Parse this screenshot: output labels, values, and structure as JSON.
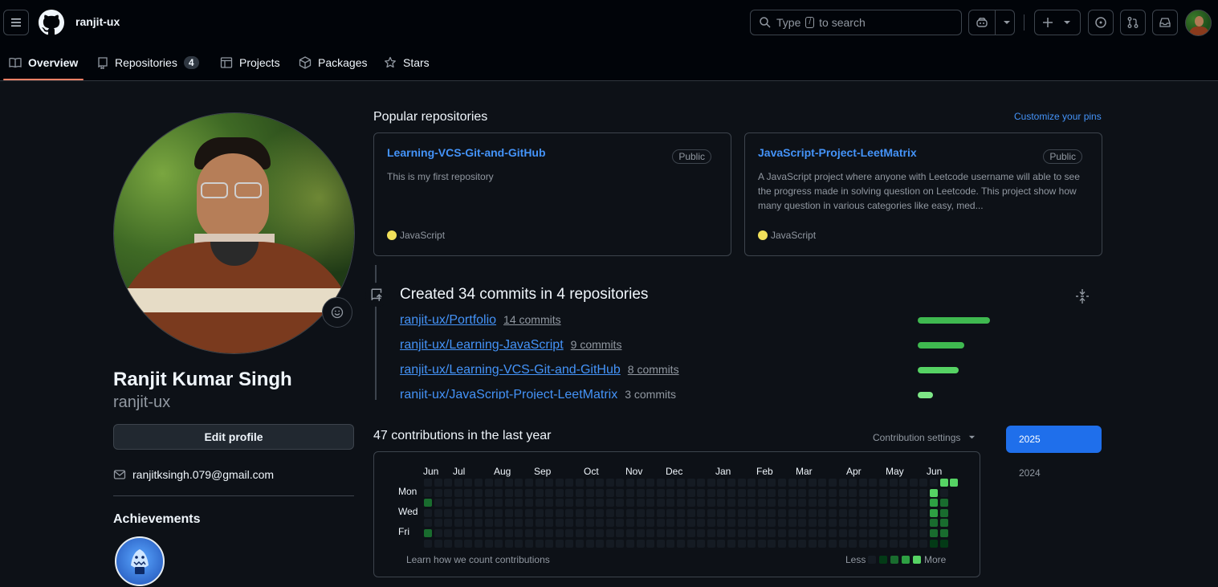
{
  "header": {
    "username": "ranjit-ux",
    "search_prefix": "Type",
    "search_key": "/",
    "search_suffix": "to search"
  },
  "tabs": [
    {
      "label": "Overview",
      "active": true
    },
    {
      "label": "Repositories",
      "count": "4"
    },
    {
      "label": "Projects"
    },
    {
      "label": "Packages"
    },
    {
      "label": "Stars"
    }
  ],
  "profile": {
    "full_name": "Ranjit Kumar Singh",
    "login": "ranjit-ux",
    "edit_button": "Edit profile",
    "email": "ranjitksingh.079@gmail.com",
    "achievements_title": "Achievements"
  },
  "popular": {
    "title": "Popular repositories",
    "customize": "Customize your pins",
    "repos": [
      {
        "name": "Learning-VCS-Git-and-GitHub",
        "visibility": "Public",
        "description": "This is my first repository",
        "language": "JavaScript"
      },
      {
        "name": "JavaScript-Project-LeetMatrix",
        "visibility": "Public",
        "description": "A JavaScript project where anyone with Leetcode username will able to see the progress made in solving question on Leetcode. This project show how many question in various categories like easy, med...",
        "language": "JavaScript"
      }
    ]
  },
  "activity": {
    "title": "Created 34 commits in 4 repositories",
    "rows": [
      {
        "repo": "ranjit-ux/Portfolio",
        "commits": "14 commits",
        "value": 14
      },
      {
        "repo": "ranjit-ux/Learning-JavaScript",
        "commits": "9 commits",
        "value": 9
      },
      {
        "repo": "ranjit-ux/Learning-VCS-Git-and-GitHub",
        "commits": "8 commits",
        "value": 8
      },
      {
        "repo": "ranjit-ux/JavaScript-Project-LeetMatrix",
        "commits": "3 commits",
        "value": 3
      }
    ]
  },
  "contributions": {
    "title": "47 contributions in the last year",
    "settings": "Contribution settings",
    "months": [
      "Jun",
      "Jul",
      "Aug",
      "Sep",
      "Oct",
      "Nov",
      "Dec",
      "Jan",
      "Feb",
      "Mar",
      "Apr",
      "May",
      "Jun"
    ],
    "days": [
      "Mon",
      "Wed",
      "Fri"
    ],
    "learn": "Learn how we count contributions",
    "less": "Less",
    "more": "More",
    "years": [
      "2025",
      "2024"
    ],
    "selected_year": "2025",
    "colors": {
      "empty": "#151b23",
      "l1": "#033a16",
      "l2": "#196c2e",
      "l3": "#2ea043",
      "l4": "#56d364"
    }
  }
}
